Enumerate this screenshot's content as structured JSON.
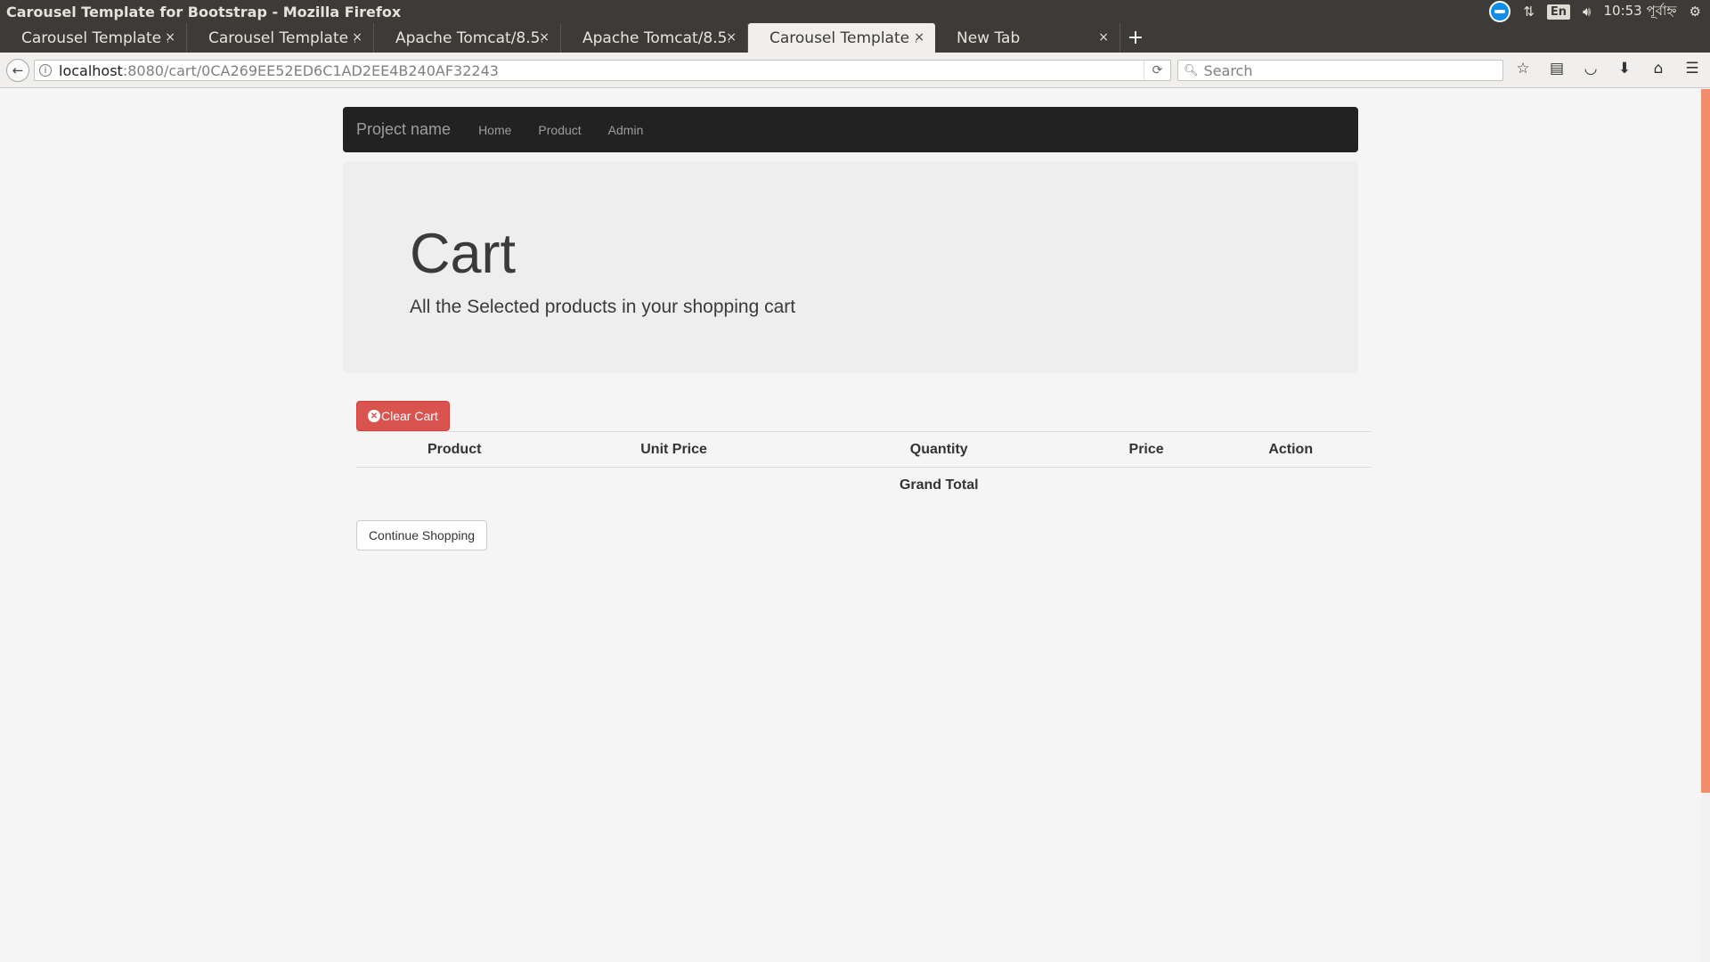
{
  "os": {
    "window_title": "Carousel Template for Bootstrap - Mozilla Firefox",
    "lang": "En",
    "clock": "10:53 পূর্বাহ্ন"
  },
  "tabs": [
    {
      "label": "Carousel Template ..."
    },
    {
      "label": "Carousel Template ..."
    },
    {
      "label": "Apache Tomcat/8.5...."
    },
    {
      "label": "Apache Tomcat/8.5...."
    },
    {
      "label": "Carousel Template ..."
    },
    {
      "label": "New Tab"
    }
  ],
  "tab_close": "×",
  "tab_new": "+",
  "urlbar": {
    "host": "localhost",
    "rest": ":8080/cart/0CA269EE52ED6C1AD2EE4B240AF32243"
  },
  "searchbar": {
    "placeholder": "Search"
  },
  "site": {
    "brand": "Project name",
    "nav": [
      "Home",
      "Product",
      "Admin"
    ]
  },
  "jumbotron": {
    "title": "Cart",
    "subtitle": "All the Selected products in your shopping cart"
  },
  "cart": {
    "clear_label": "Clear Cart",
    "columns": [
      "Product",
      "Unit Price",
      "Quantity",
      "Price",
      "Action"
    ],
    "grand_total_label": "Grand Total",
    "continue_label": "Continue Shopping"
  },
  "colors": {
    "danger": "#d9534f",
    "navbar": "#222222",
    "scroll_thumb": "#f08e6c"
  }
}
